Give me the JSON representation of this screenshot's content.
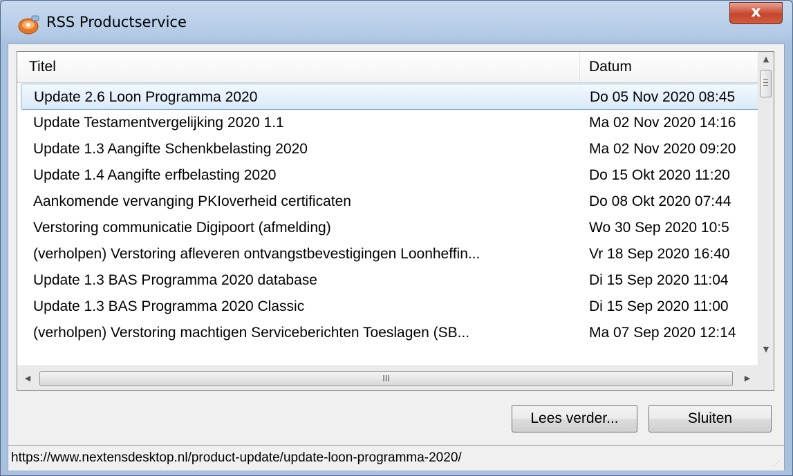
{
  "window": {
    "title": "RSS Productservice",
    "close_label": "x"
  },
  "list": {
    "columns": {
      "title": "Titel",
      "date": "Datum"
    },
    "rows": [
      {
        "title": "Update 2.6 Loon Programma 2020",
        "date": "Do 05 Nov 2020 08:45",
        "selected": true
      },
      {
        "title": "Update Testamentvergelijking 2020 1.1",
        "date": "Ma 02 Nov 2020 14:16"
      },
      {
        "title": "Update 1.3 Aangifte Schenkbelasting 2020",
        "date": "Ma 02 Nov 2020 09:20"
      },
      {
        "title": "Update 1.4 Aangifte erfbelasting 2020",
        "date": "Do 15 Okt 2020 11:20"
      },
      {
        "title": "Aankomende vervanging PKIoverheid certificaten",
        "date": "Do 08 Okt 2020 07:44"
      },
      {
        "title": "Verstoring communicatie Digipoort (afmelding)",
        "date": "Wo 30 Sep 2020 10:5"
      },
      {
        "title": "(verholpen) Verstoring afleveren ontvangstbevestigingen Loonheffin...",
        "date": "Vr 18 Sep 2020 16:40"
      },
      {
        "title": "Update 1.3 BAS Programma 2020 database",
        "date": "Di 15 Sep 2020 11:04"
      },
      {
        "title": "Update 1.3 BAS Programma 2020 Classic",
        "date": "Di 15 Sep 2020 11:00"
      },
      {
        "title": "(verholpen) Verstoring machtigen Serviceberichten Toeslagen (SB...",
        "date": "Ma 07 Sep 2020 12:14"
      }
    ]
  },
  "buttons": {
    "read_more": "Lees verder...",
    "close": "Sluiten"
  },
  "status": {
    "url": "https://www.nextensdesktop.nl/product-update/update-loon-programma-2020/"
  },
  "icons": {
    "app": "rss-app-icon",
    "scroll_up": "▲",
    "scroll_down": "▼",
    "scroll_left": "◀",
    "scroll_right": "▶",
    "thumb_grip": "III"
  },
  "colors": {
    "selection": "#dbeaf9",
    "titlebar": "#b3cae6",
    "close": "#c7452d"
  }
}
